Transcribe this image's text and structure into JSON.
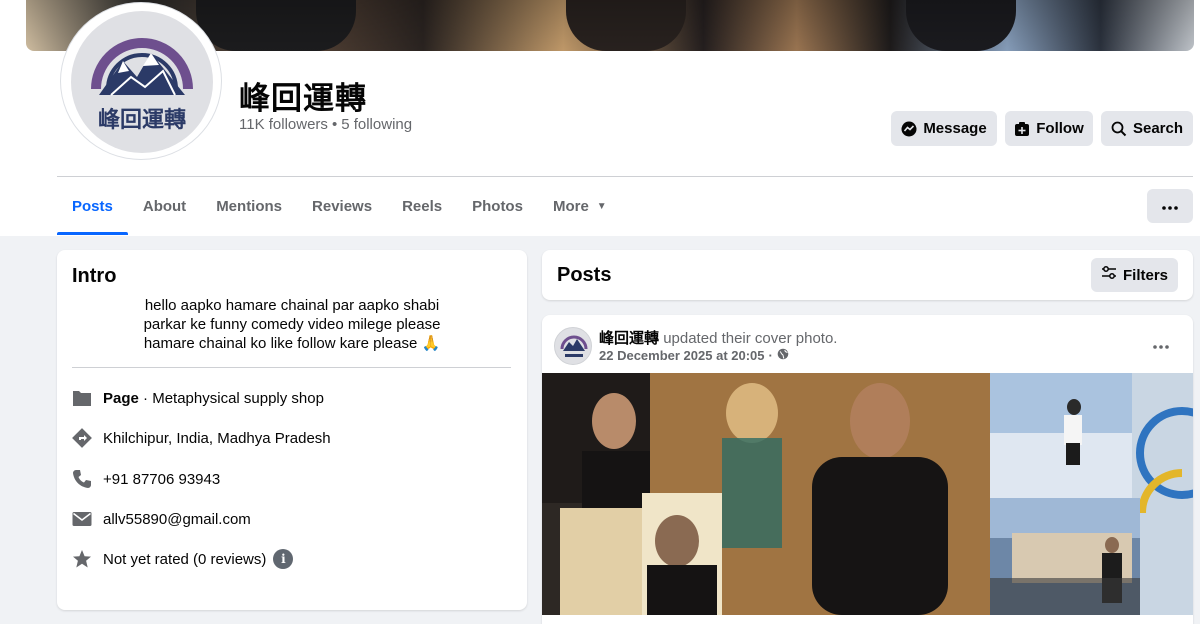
{
  "header": {
    "page_name": "峰回運轉",
    "followers": "11K followers",
    "separator": "•",
    "following": "5 following",
    "buttons": {
      "message": "Message",
      "follow": "Follow",
      "search": "Search"
    }
  },
  "logo": {
    "text": "峰回運轉"
  },
  "tabs": [
    {
      "label": "Posts",
      "active": true
    },
    {
      "label": "About"
    },
    {
      "label": "Mentions"
    },
    {
      "label": "Reviews"
    },
    {
      "label": "Reels"
    },
    {
      "label": "Photos"
    },
    {
      "label": "More"
    }
  ],
  "intro": {
    "title": "Intro",
    "bio_lines": [
      "hello aapko hamare chainal par aapko shabi",
      "parkar ke funny comedy video milege please",
      "hamare chainal ko like follow kare please 🙏"
    ],
    "details": {
      "page_label": "Page",
      "page_sep": " · ",
      "category": "Metaphysical supply shop",
      "location": "Khilchipur, India, Madhya Pradesh",
      "phone": "+91 87706 93943",
      "email": "allv55890@gmail.com",
      "rating": "Not yet rated (0 reviews)",
      "info_glyph": "i"
    }
  },
  "posts": {
    "title": "Posts",
    "filters_label": "Filters",
    "post": {
      "author": "峰回運轉",
      "action": "updated their cover photo.",
      "date": "22 December 2025 at 20:05",
      "date_sep": "·"
    }
  },
  "icons": {
    "message": "messenger-icon",
    "follow": "follow-icon",
    "search": "search-icon",
    "page": "flag-icon",
    "location": "location-icon",
    "phone": "phone-icon",
    "email": "email-icon",
    "rating": "star-icon",
    "globe": "globe-icon"
  },
  "colors": {
    "accent": "#0866ff",
    "logo_navy": "#2b3a67",
    "logo_purple": "#6e4f8e"
  }
}
